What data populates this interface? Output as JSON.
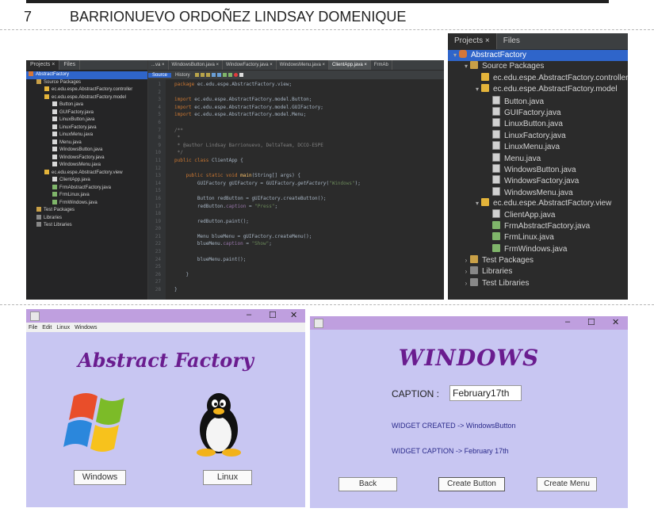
{
  "heading": {
    "number": "7",
    "text": "BARRIONUEVO ORDOÑEZ LINDSAY DOMENIQUE"
  },
  "ide": {
    "project_tabs": [
      "Projects ×",
      "Files"
    ],
    "tree": [
      {
        "label": "AbstractFactory",
        "kind": "cup",
        "indent": 0,
        "selected": true
      },
      {
        "label": "Source Packages",
        "kind": "fld",
        "indent": 1
      },
      {
        "label": "ec.edu.espe.AbstractFactory.controller",
        "kind": "pkg",
        "indent": 2
      },
      {
        "label": "ec.edu.espe.AbstractFactory.model",
        "kind": "pkg",
        "indent": 2
      },
      {
        "label": "Button.java",
        "kind": "jv",
        "indent": 3
      },
      {
        "label": "GUIFactory.java",
        "kind": "jv",
        "indent": 3
      },
      {
        "label": "LinuxButton.java",
        "kind": "jv",
        "indent": 3
      },
      {
        "label": "LinuxFactory.java",
        "kind": "jv",
        "indent": 3
      },
      {
        "label": "LinuxMenu.java",
        "kind": "jv",
        "indent": 3
      },
      {
        "label": "Menu.java",
        "kind": "jv",
        "indent": 3
      },
      {
        "label": "WindowsButton.java",
        "kind": "jv",
        "indent": 3
      },
      {
        "label": "WindowsFactory.java",
        "kind": "jv",
        "indent": 3
      },
      {
        "label": "WindowsMenu.java",
        "kind": "jv",
        "indent": 3
      },
      {
        "label": "ec.edu.espe.AbstractFactory.view",
        "kind": "pkg",
        "indent": 2
      },
      {
        "label": "ClientApp.java",
        "kind": "jv",
        "indent": 3
      },
      {
        "label": "FrmAbstractFactory.java",
        "kind": "frm",
        "indent": 3
      },
      {
        "label": "FrmLinux.java",
        "kind": "frm",
        "indent": 3
      },
      {
        "label": "FrmWindows.java",
        "kind": "frm",
        "indent": 3
      },
      {
        "label": "Test Packages",
        "kind": "fld",
        "indent": 1
      },
      {
        "label": "Libraries",
        "kind": "lib",
        "indent": 1
      },
      {
        "label": "Test Libraries",
        "kind": "lib",
        "indent": 1
      }
    ],
    "editor_tabs": [
      "...va ×",
      "WindowsButton.java ×",
      "WindowFactory.java ×",
      "WindowsMenu.java ×",
      "ClientApp.java ×",
      "FrmAb"
    ],
    "editor_toolbar": {
      "source": "Source",
      "history": "History"
    },
    "code": [
      {
        "n": "1",
        "html": "<span class='kw'>package</span> ec.edu.espe.AbstractFactory.view;"
      },
      {
        "n": "2",
        "html": ""
      },
      {
        "n": "3",
        "html": "<span class='kw'>import</span> ec.edu.espe.AbstractFactory.model.Button;"
      },
      {
        "n": "4",
        "html": "<span class='kw'>import</span> ec.edu.espe.AbstractFactory.model.GUIFactory;"
      },
      {
        "n": "5",
        "html": "<span class='kw'>import</span> ec.edu.espe.AbstractFactory.model.Menu;"
      },
      {
        "n": "6",
        "html": ""
      },
      {
        "n": "7",
        "html": "<span class='cm'>/**</span>"
      },
      {
        "n": "8",
        "html": "<span class='cm'> *</span>"
      },
      {
        "n": "9",
        "html": "<span class='cm'> * @author Lindsay Barrionuevo, DeltaTeam, DCCO-ESPE</span>"
      },
      {
        "n": "10",
        "html": "<span class='cm'> */</span>"
      },
      {
        "n": "11",
        "html": "<span class='kw'>public class</span> ClientApp {"
      },
      {
        "n": "12",
        "html": ""
      },
      {
        "n": "13",
        "html": "    <span class='kw'>public static void</span> <span class='fn'>main</span>(String[] args) {"
      },
      {
        "n": "14",
        "html": "        GUIFactory gUIFactory = GUIFactory.<i>getFactory</i>(<span class='st'>\"Windows\"</span>);"
      },
      {
        "n": "15",
        "html": ""
      },
      {
        "n": "16",
        "html": "        Button redButton = gUIFactory.createButton();"
      },
      {
        "n": "17",
        "html": "        redButton.<span class='fd'>caption</span> = <span class='st'>\"Press\"</span>;"
      },
      {
        "n": "18",
        "html": ""
      },
      {
        "n": "19",
        "html": "        redButton.paint();"
      },
      {
        "n": "20",
        "html": ""
      },
      {
        "n": "21",
        "html": "        Menu blueMenu = gUIFactory.createMenu();"
      },
      {
        "n": "22",
        "html": "        blueMenu.<span class='fd'>caption</span> = <span class='st'>\"Show\"</span>;"
      },
      {
        "n": "23",
        "html": ""
      },
      {
        "n": "24",
        "html": "        blueMenu.paint();"
      },
      {
        "n": "25",
        "html": ""
      },
      {
        "n": "26",
        "html": "    }"
      },
      {
        "n": "27",
        "html": ""
      },
      {
        "n": "28",
        "html": "}"
      }
    ]
  },
  "project_panel": {
    "tabs": [
      "Projects ×",
      "Files"
    ]
  },
  "abstract_window": {
    "controls": [
      "–",
      "☐",
      "✕"
    ],
    "menu": [
      "File",
      "Edit",
      "Linux",
      "Windows"
    ],
    "title": "Abstract Factory",
    "windows_button": "Windows",
    "linux_button": "Linux"
  },
  "windows_window": {
    "controls": [
      "–",
      "☐",
      "✕"
    ],
    "title": "WINDOWS",
    "caption_label": "CAPTION :",
    "caption_value": "February17th",
    "widget_created": "WIDGET CREATED -> WindowsButton",
    "widget_caption": "WIDGET CAPTION -> February 17th",
    "back_button": "Back",
    "create_button": "Create Button",
    "create_menu": "Create Menu"
  }
}
